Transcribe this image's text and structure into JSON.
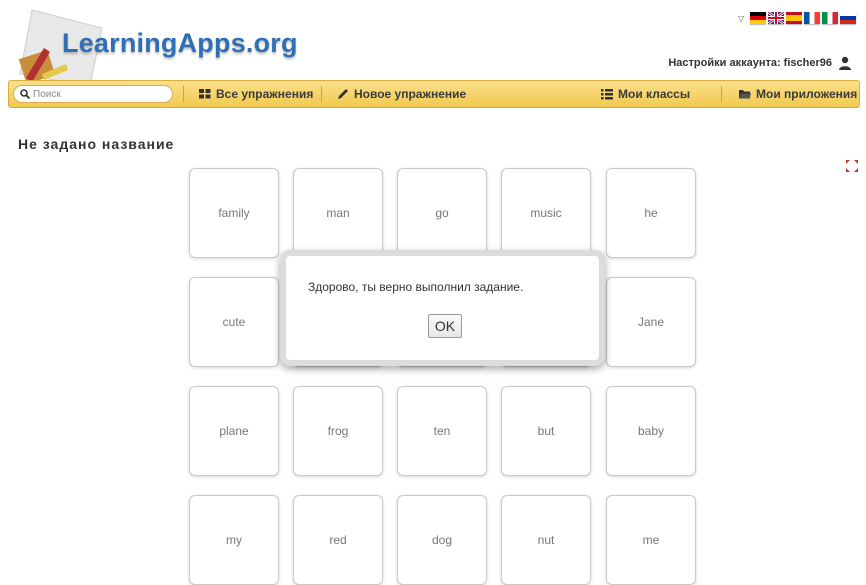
{
  "header": {
    "logo_text": "LearningApps.org",
    "account_label": "Настройки аккаунта: fischer96",
    "language_flags": [
      "german-flag",
      "uk-flag",
      "spanish-flag",
      "french-flag",
      "italian-flag",
      "russian-flag"
    ]
  },
  "nav": {
    "search_placeholder": "Поиск",
    "all_exercises": "Все упражнения",
    "new_exercise": "Новое упражнение",
    "my_classes": "Мои классы",
    "my_apps": "Мои приложения"
  },
  "page": {
    "title": "Не задано название"
  },
  "cards": [
    [
      "family",
      "man",
      "go",
      "music",
      "he"
    ],
    [
      "cute",
      "",
      "",
      "",
      "Jane"
    ],
    [
      "plane",
      "frog",
      "ten",
      "but",
      "baby"
    ],
    [
      "my",
      "red",
      "dog",
      "nut",
      "me"
    ]
  ],
  "dialog": {
    "message": "Здорово, ты верно выполнил задание.",
    "ok_label": "OK"
  },
  "colors": {
    "nav_bar": "#f1c94f",
    "logo_blue": "#2f6fb4"
  }
}
